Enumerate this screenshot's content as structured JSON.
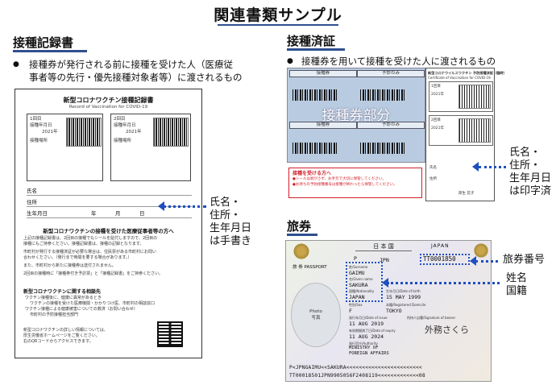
{
  "page_title": "関連書類サンプル",
  "colors": {
    "accent": "#2f4f8f",
    "arrow": "#1f4fbf",
    "red": "#d0202a",
    "cert_blue": "#b9cbe0"
  },
  "record_section": {
    "title": "接種記録書",
    "bullet": "●",
    "desc_line1": "接種券が発行される前に接種を受けた人（医療従",
    "desc_line2": "事者等の先行・優先接種対象者等）に渡されるもの",
    "doc": {
      "title": "新型コロナワクチン接種記録書",
      "subtitle": "Record of Vaccination for COVID-19",
      "box1_dose": "1回目",
      "box2_dose": "2回目",
      "box_vaccine_label": "接種年月日",
      "box_year": "2021年",
      "box_place_label": "接種場所",
      "field_name": "氏名",
      "field_address": "住所",
      "field_dob": "生年月日",
      "dob_units": [
        "年",
        "月",
        "日"
      ],
      "notice_title": "新型コロナワクチンの接種を受けた医療従事者等の方へ",
      "notice_items": [
        "上記の接種記録書は、2回目の接種でもシールを貼付しますので、2回目の",
        "接種にもご持参ください。接種記録書は、接種の記録となります。",
        "市町村が発行する接種済証が必要な場合は、住民票がある市町村にお問い",
        "合わせください。（発行まで時間を要する場合があります。）",
        "また、市町村から新たに接種券は送付されません。",
        "2回目の接種時に「接種券付き予診票」と「接種記録書」をご持参ください。"
      ],
      "consult_title": "新型コロナワクチンに関する相談先",
      "consult_items": [
        "ワクチン接種後に、健康に異常があるとき",
        "ワクチンの接種を受けた医療機関・かかりつけ医、市町村の相談窓口",
        "ワクチン接種による健康被害についての救済（お問い合わせ）",
        "市町村の予防接種担当部門"
      ],
      "footer_line1": "新型コロナワクチンの詳しい情報については、",
      "footer_line2": "厚生労働省ホームページをご覧ください。",
      "footer_line3": "右のQRコードからアクセスできます。"
    },
    "annotation_lines": [
      "氏名・",
      "住所・",
      "生年月日",
      "は手書き"
    ]
  },
  "cert_section": {
    "title": "接種済証",
    "bullet": "●",
    "desc": "接種券を用いて接種を受けた人に渡されるもの",
    "coupon_overlay": "接種券部分",
    "col_headers": [
      "接種券",
      "予診のみ",
      "接種券",
      "予診のみ"
    ],
    "red_box_title": "接種を受ける方へ",
    "red_box_line1": "●シールは剥がさず、お手元で大切に保管してください。",
    "red_box_line2": "●お持ちの予防接種番号は接種が終わったら保管してください。",
    "cert_title": "新型コロナウイルスワクチン 予防接種済証（臨時）",
    "cert_subtitle": "Certificate of Vaccination for COVID-19",
    "cert_dose1": "1回目",
    "cert_dose2": "2回目",
    "cert_year": "2021年",
    "cert_name_label": "氏名",
    "cert_address_label": "住所",
    "cert_name_value": "厚生 花子",
    "annotation_lines": [
      "氏名・",
      "住所・",
      "生年月日",
      "は印字済"
    ]
  },
  "passport_section": {
    "title": "旅券",
    "header_jp": "日 本 国",
    "header_en": "JAPAN",
    "type_label": "旅 券 PASSPORT",
    "type_value": "P",
    "code_value": "JPN",
    "passport_no": "TT0001850",
    "surname_label": "姓/Surname",
    "surname": "GAIMU",
    "given_label": "名/Given name",
    "given": "SAKURA",
    "nationality_label": "国籍/Nationality",
    "nationality": "JAPAN",
    "dob_label": "生年月日/Date of birth",
    "dob": "15 MAY 1999",
    "sex_label": "性別/Sex",
    "sex": "F",
    "domicile_label": "本籍/Registered Domicile",
    "domicile": "TOKYO",
    "issue_label": "発行年月日/Date of issue",
    "issue": "11 AUG 2019",
    "signature_label": "所持人自署/Signature of bearer",
    "signature": "外務さくら",
    "expiry_label": "有効期間満了日/Date of expiry",
    "expiry": "11 AUG 2024",
    "authority_label": "発行官庁/Authority",
    "authority_line1": "MINISTRY OF",
    "authority_line2": "FOREIGN AFFAIRS",
    "photo_label_line1": "Photo",
    "photo_label_line2": "写真",
    "mrz1": "P<JPNGAIMU<<SAKURA<<<<<<<<<<<<<<<<<<<<<<<<",
    "mrz2": "TT00018501JPN9905056F2408119<<<<<<<<<<<<<08",
    "annotation_passport_no": "旅券番号",
    "annotation_name_lines": [
      "姓名",
      "国籍"
    ]
  }
}
